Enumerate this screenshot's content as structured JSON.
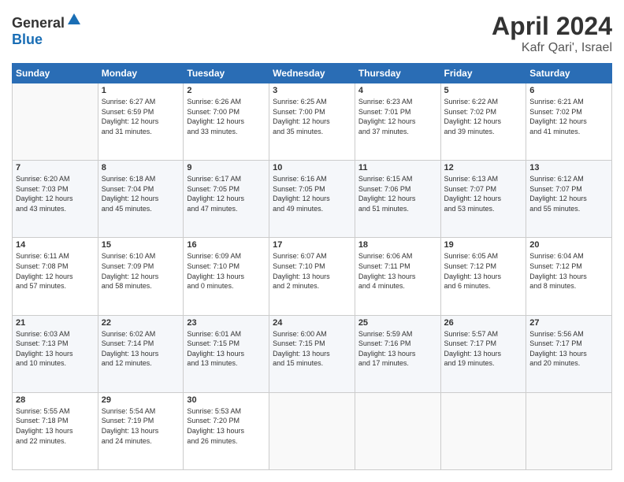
{
  "header": {
    "logo_general": "General",
    "logo_blue": "Blue",
    "month": "April 2024",
    "location": "Kafr Qari', Israel"
  },
  "weekdays": [
    "Sunday",
    "Monday",
    "Tuesday",
    "Wednesday",
    "Thursday",
    "Friday",
    "Saturday"
  ],
  "weeks": [
    [
      {
        "day": "",
        "info": ""
      },
      {
        "day": "1",
        "info": "Sunrise: 6:27 AM\nSunset: 6:59 PM\nDaylight: 12 hours\nand 31 minutes."
      },
      {
        "day": "2",
        "info": "Sunrise: 6:26 AM\nSunset: 7:00 PM\nDaylight: 12 hours\nand 33 minutes."
      },
      {
        "day": "3",
        "info": "Sunrise: 6:25 AM\nSunset: 7:00 PM\nDaylight: 12 hours\nand 35 minutes."
      },
      {
        "day": "4",
        "info": "Sunrise: 6:23 AM\nSunset: 7:01 PM\nDaylight: 12 hours\nand 37 minutes."
      },
      {
        "day": "5",
        "info": "Sunrise: 6:22 AM\nSunset: 7:02 PM\nDaylight: 12 hours\nand 39 minutes."
      },
      {
        "day": "6",
        "info": "Sunrise: 6:21 AM\nSunset: 7:02 PM\nDaylight: 12 hours\nand 41 minutes."
      }
    ],
    [
      {
        "day": "7",
        "info": "Sunrise: 6:20 AM\nSunset: 7:03 PM\nDaylight: 12 hours\nand 43 minutes."
      },
      {
        "day": "8",
        "info": "Sunrise: 6:18 AM\nSunset: 7:04 PM\nDaylight: 12 hours\nand 45 minutes."
      },
      {
        "day": "9",
        "info": "Sunrise: 6:17 AM\nSunset: 7:05 PM\nDaylight: 12 hours\nand 47 minutes."
      },
      {
        "day": "10",
        "info": "Sunrise: 6:16 AM\nSunset: 7:05 PM\nDaylight: 12 hours\nand 49 minutes."
      },
      {
        "day": "11",
        "info": "Sunrise: 6:15 AM\nSunset: 7:06 PM\nDaylight: 12 hours\nand 51 minutes."
      },
      {
        "day": "12",
        "info": "Sunrise: 6:13 AM\nSunset: 7:07 PM\nDaylight: 12 hours\nand 53 minutes."
      },
      {
        "day": "13",
        "info": "Sunrise: 6:12 AM\nSunset: 7:07 PM\nDaylight: 12 hours\nand 55 minutes."
      }
    ],
    [
      {
        "day": "14",
        "info": "Sunrise: 6:11 AM\nSunset: 7:08 PM\nDaylight: 12 hours\nand 57 minutes."
      },
      {
        "day": "15",
        "info": "Sunrise: 6:10 AM\nSunset: 7:09 PM\nDaylight: 12 hours\nand 58 minutes."
      },
      {
        "day": "16",
        "info": "Sunrise: 6:09 AM\nSunset: 7:10 PM\nDaylight: 13 hours\nand 0 minutes."
      },
      {
        "day": "17",
        "info": "Sunrise: 6:07 AM\nSunset: 7:10 PM\nDaylight: 13 hours\nand 2 minutes."
      },
      {
        "day": "18",
        "info": "Sunrise: 6:06 AM\nSunset: 7:11 PM\nDaylight: 13 hours\nand 4 minutes."
      },
      {
        "day": "19",
        "info": "Sunrise: 6:05 AM\nSunset: 7:12 PM\nDaylight: 13 hours\nand 6 minutes."
      },
      {
        "day": "20",
        "info": "Sunrise: 6:04 AM\nSunset: 7:12 PM\nDaylight: 13 hours\nand 8 minutes."
      }
    ],
    [
      {
        "day": "21",
        "info": "Sunrise: 6:03 AM\nSunset: 7:13 PM\nDaylight: 13 hours\nand 10 minutes."
      },
      {
        "day": "22",
        "info": "Sunrise: 6:02 AM\nSunset: 7:14 PM\nDaylight: 13 hours\nand 12 minutes."
      },
      {
        "day": "23",
        "info": "Sunrise: 6:01 AM\nSunset: 7:15 PM\nDaylight: 13 hours\nand 13 minutes."
      },
      {
        "day": "24",
        "info": "Sunrise: 6:00 AM\nSunset: 7:15 PM\nDaylight: 13 hours\nand 15 minutes."
      },
      {
        "day": "25",
        "info": "Sunrise: 5:59 AM\nSunset: 7:16 PM\nDaylight: 13 hours\nand 17 minutes."
      },
      {
        "day": "26",
        "info": "Sunrise: 5:57 AM\nSunset: 7:17 PM\nDaylight: 13 hours\nand 19 minutes."
      },
      {
        "day": "27",
        "info": "Sunrise: 5:56 AM\nSunset: 7:17 PM\nDaylight: 13 hours\nand 20 minutes."
      }
    ],
    [
      {
        "day": "28",
        "info": "Sunrise: 5:55 AM\nSunset: 7:18 PM\nDaylight: 13 hours\nand 22 minutes."
      },
      {
        "day": "29",
        "info": "Sunrise: 5:54 AM\nSunset: 7:19 PM\nDaylight: 13 hours\nand 24 minutes."
      },
      {
        "day": "30",
        "info": "Sunrise: 5:53 AM\nSunset: 7:20 PM\nDaylight: 13 hours\nand 26 minutes."
      },
      {
        "day": "",
        "info": ""
      },
      {
        "day": "",
        "info": ""
      },
      {
        "day": "",
        "info": ""
      },
      {
        "day": "",
        "info": ""
      }
    ]
  ]
}
